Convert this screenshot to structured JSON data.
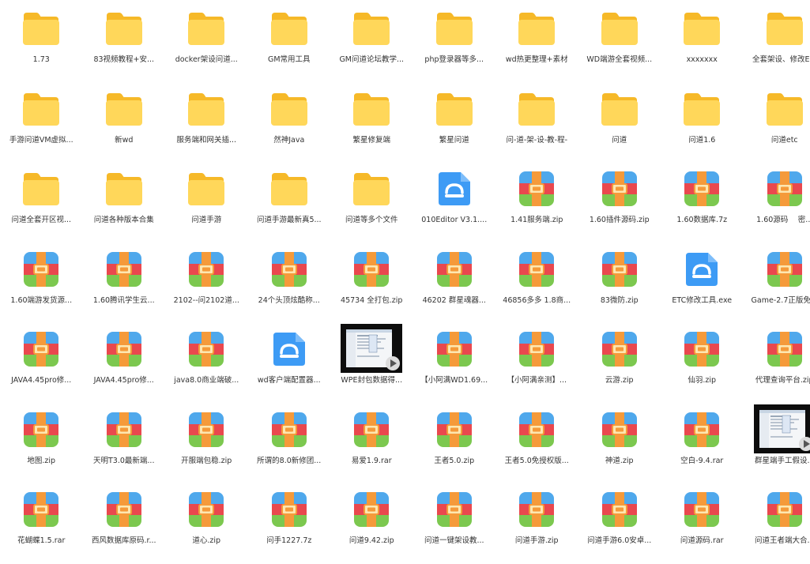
{
  "colors": {
    "folder_back": "#F6B928",
    "folder_front": "#FFD75A",
    "archive_top": "#4FA8EC",
    "archive_mid": "#E9484E",
    "archive_bottom": "#7CC84F",
    "archive_strap": "#F59A3A",
    "exe_blue": "#3D9BF5",
    "label_text": "#333333"
  },
  "items": [
    {
      "label": "1.73",
      "icon": "folder-icon"
    },
    {
      "label": "83视频教程+安...",
      "icon": "folder-icon"
    },
    {
      "label": "docker架设问道...",
      "icon": "folder-icon"
    },
    {
      "label": "GM常用工具",
      "icon": "folder-icon"
    },
    {
      "label": "GM问道论坛教学...",
      "icon": "folder-icon"
    },
    {
      "label": "php登录器等多...",
      "icon": "folder-icon"
    },
    {
      "label": "wd热更整理+素材",
      "icon": "folder-icon"
    },
    {
      "label": "WD端游全套视频...",
      "icon": "folder-icon"
    },
    {
      "label": "xxxxxxx",
      "icon": "folder-icon"
    },
    {
      "label": "全套架设、修改E...",
      "icon": "folder-icon"
    },
    {
      "label": "手游问道VM虚拟...",
      "icon": "folder-icon"
    },
    {
      "label": "新wd",
      "icon": "folder-icon"
    },
    {
      "label": "服务端和网关插...",
      "icon": "folder-icon"
    },
    {
      "label": "然神Java",
      "icon": "folder-icon"
    },
    {
      "label": "繁星修复端",
      "icon": "folder-icon"
    },
    {
      "label": "繁星问道",
      "icon": "folder-icon"
    },
    {
      "label": "问-道-架-设-教-程-",
      "icon": "folder-icon"
    },
    {
      "label": "问道",
      "icon": "folder-icon"
    },
    {
      "label": "问道1.6",
      "icon": "folder-icon"
    },
    {
      "label": "问道etc",
      "icon": "folder-icon"
    },
    {
      "label": "问道全套开区视...",
      "icon": "folder-icon"
    },
    {
      "label": "问道各种版本合集",
      "icon": "folder-icon"
    },
    {
      "label": "问道手游",
      "icon": "folder-icon"
    },
    {
      "label": "问道手游最新真5...",
      "icon": "folder-icon"
    },
    {
      "label": "问道等多个文件",
      "icon": "folder-icon"
    },
    {
      "label": "010Editor V3.1....",
      "icon": "exe-icon"
    },
    {
      "label": "1.41服务端.zip",
      "icon": "archive-icon"
    },
    {
      "label": "1.60插件源码.zip",
      "icon": "archive-icon"
    },
    {
      "label": "1.60数据库.7z",
      "icon": "archive-icon"
    },
    {
      "label": "1.60源码　 密...",
      "icon": "archive-icon"
    },
    {
      "label": "1.60端游发货源...",
      "icon": "archive-icon"
    },
    {
      "label": "1.60腾讯学生云...",
      "icon": "archive-icon"
    },
    {
      "label": "2102--问2102道...",
      "icon": "archive-icon"
    },
    {
      "label": "24个头顶炫酷称...",
      "icon": "archive-icon"
    },
    {
      "label": "45734 全打包.zip",
      "icon": "archive-icon"
    },
    {
      "label": "46202 群星魂器...",
      "icon": "archive-icon"
    },
    {
      "label": "46856多多 1.8商...",
      "icon": "archive-icon"
    },
    {
      "label": "83微防.zip",
      "icon": "archive-icon"
    },
    {
      "label": "ETC修改工具.exe",
      "icon": "exe-icon"
    },
    {
      "label": "Game-2.7正版免...",
      "icon": "archive-icon"
    },
    {
      "label": "JAVA4.45pro修...",
      "icon": "archive-icon"
    },
    {
      "label": "JAVA4.45pro修...",
      "icon": "archive-icon"
    },
    {
      "label": "java8.0商业端破...",
      "icon": "archive-icon"
    },
    {
      "label": "wd客户端配置器...",
      "icon": "exe-icon"
    },
    {
      "label": "WPE封包数据得...",
      "icon": "video-thumbnail"
    },
    {
      "label": "【小阿满WD1.69...",
      "icon": "archive-icon"
    },
    {
      "label": "【小阿满亲测】...",
      "icon": "archive-icon"
    },
    {
      "label": "云游.zip",
      "icon": "archive-icon"
    },
    {
      "label": "仙羽.zip",
      "icon": "archive-icon"
    },
    {
      "label": "代理查询平台.zip",
      "icon": "archive-icon"
    },
    {
      "label": "地图.zip",
      "icon": "archive-icon"
    },
    {
      "label": "天明T3.0最新端...",
      "icon": "archive-icon"
    },
    {
      "label": "开服端包稳.zip",
      "icon": "archive-icon"
    },
    {
      "label": "所谓的8.0新修团...",
      "icon": "archive-icon"
    },
    {
      "label": "易爱1.9.rar",
      "icon": "archive-icon"
    },
    {
      "label": "王者5.0.zip",
      "icon": "archive-icon"
    },
    {
      "label": "王者5.0免授权版...",
      "icon": "archive-icon"
    },
    {
      "label": "神道.zip",
      "icon": "archive-icon"
    },
    {
      "label": "空白-9.4.rar",
      "icon": "archive-icon"
    },
    {
      "label": "群星端手工假设...",
      "icon": "video-thumbnail"
    },
    {
      "label": "花蝴蝶1.5.rar",
      "icon": "archive-icon"
    },
    {
      "label": "西风数据库原码.r...",
      "icon": "archive-icon"
    },
    {
      "label": "道心.zip",
      "icon": "archive-icon"
    },
    {
      "label": "问手1227.7z",
      "icon": "archive-icon"
    },
    {
      "label": "问道9.42.zip",
      "icon": "archive-icon"
    },
    {
      "label": "问道一键架设教...",
      "icon": "archive-icon"
    },
    {
      "label": "问道手游.zip",
      "icon": "archive-icon"
    },
    {
      "label": "问道手游6.0安卓...",
      "icon": "archive-icon"
    },
    {
      "label": "问道源码.rar",
      "icon": "archive-icon"
    },
    {
      "label": "问道王者端大合...",
      "icon": "archive-icon"
    }
  ]
}
